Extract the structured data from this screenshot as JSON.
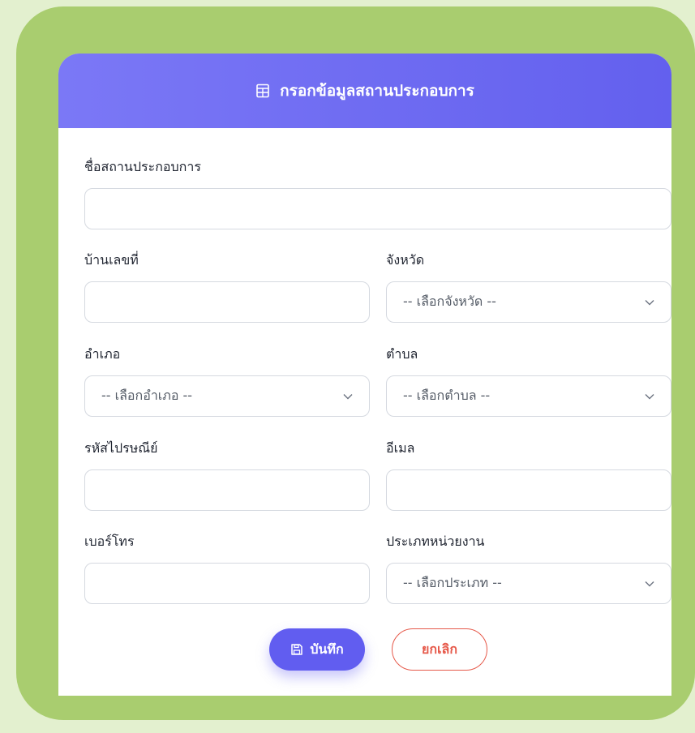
{
  "header": {
    "title": "กรอกข้อมูลสถานประกอบการ",
    "icon": "building-icon"
  },
  "form": {
    "establishment_name": {
      "label": "ชื่อสถานประกอบการ",
      "value": ""
    },
    "house_number": {
      "label": "บ้านเลขที่",
      "value": ""
    },
    "province": {
      "label": "จังหวัด",
      "selected": "-- เลือกจังหวัด --"
    },
    "district": {
      "label": "อำเภอ",
      "selected": "-- เลือกอำเภอ --"
    },
    "subdistrict": {
      "label": "ตำบล",
      "selected": "-- เลือกตำบล --"
    },
    "postal_code": {
      "label": "รหัสไปรษณีย์",
      "value": ""
    },
    "email": {
      "label": "อีเมล",
      "value": ""
    },
    "phone": {
      "label": "เบอร์โทร",
      "value": ""
    },
    "agency_type": {
      "label": "ประเภทหน่วยงาน",
      "selected": "-- เลือกประเภท --"
    }
  },
  "actions": {
    "save_label": "บันทึก",
    "cancel_label": "ยกเลิก"
  },
  "colors": {
    "page_bg": "#e3f0cf",
    "frame": "#a9cd6f",
    "header_gradient_start": "#7b78f6",
    "header_gradient_end": "#6360ee",
    "primary": "#615df0",
    "danger": "#e6594a"
  }
}
